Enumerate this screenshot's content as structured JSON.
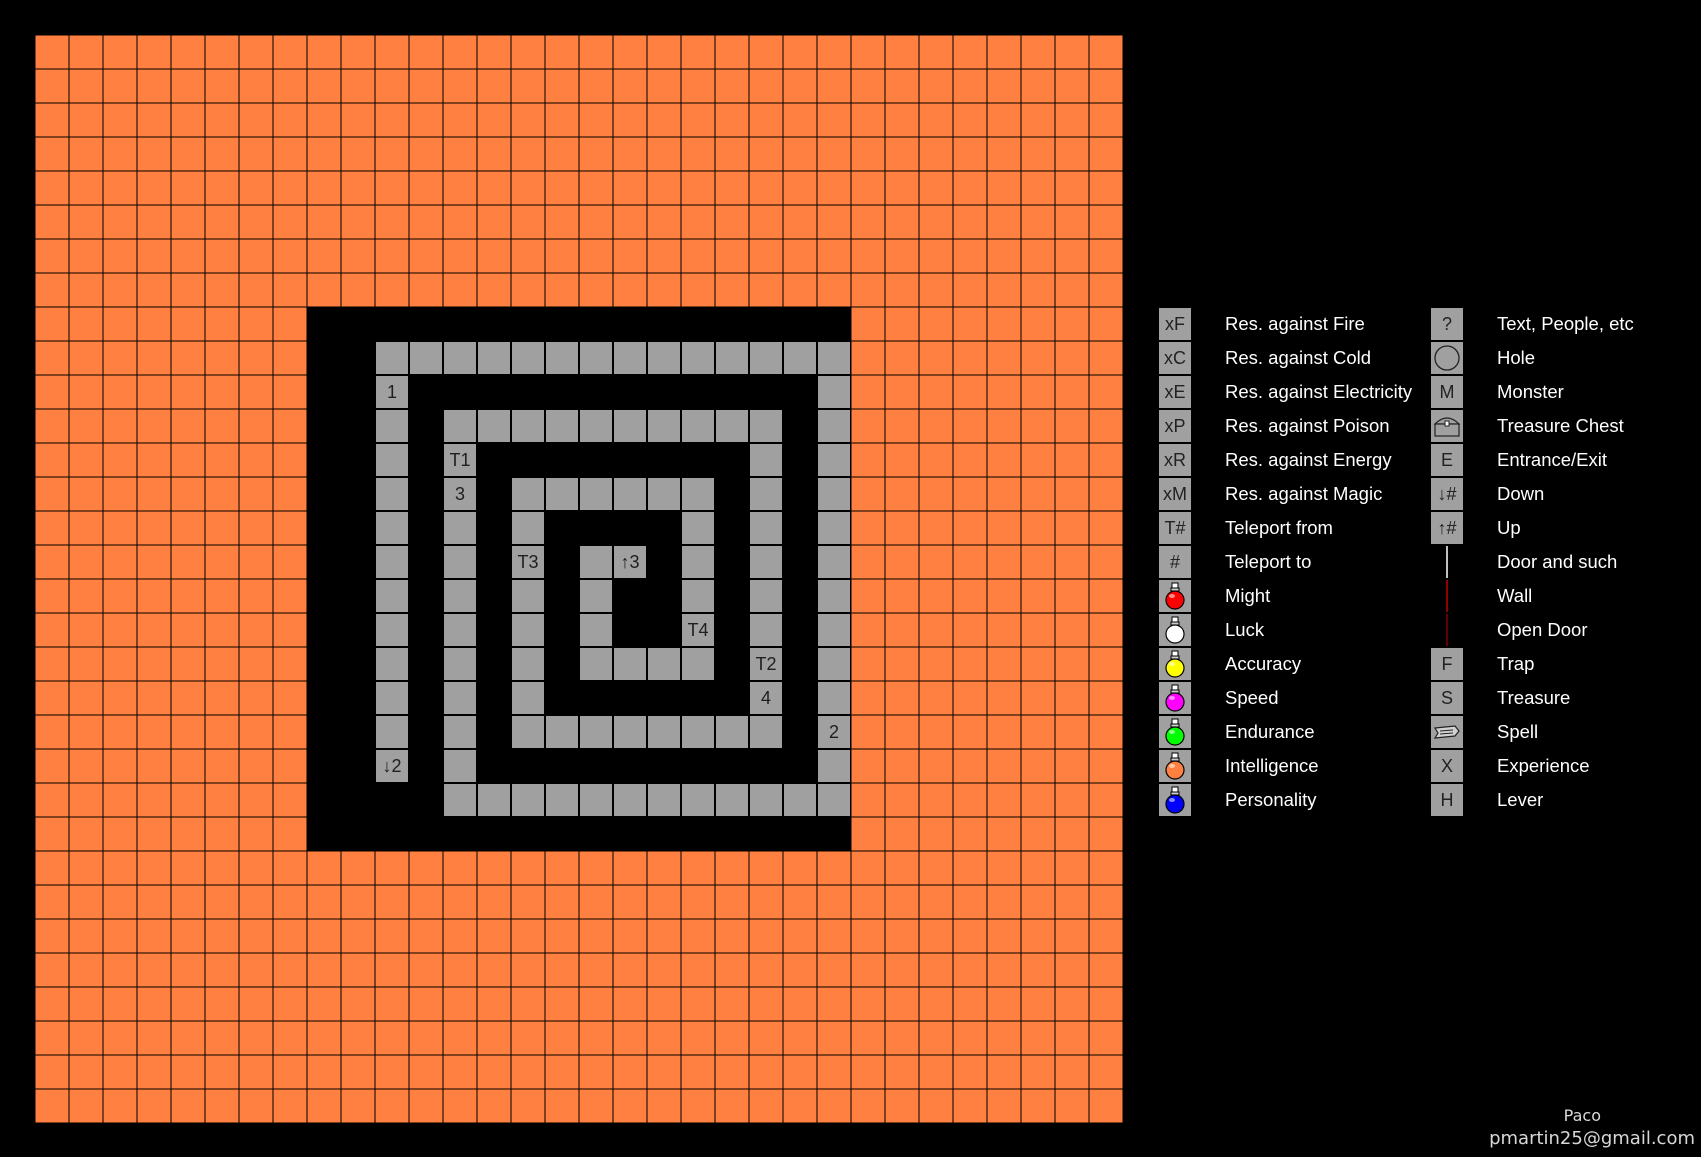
{
  "map": {
    "columns": 32,
    "rows": 32,
    "colors": {
      "outer": "#ff8040",
      "gridline": "#000000",
      "wall": "#000000",
      "floor": "#a0a0a0",
      "cell_text": "#202020"
    },
    "floor_cells": [
      [
        10,
        9
      ],
      [
        11,
        9
      ],
      [
        12,
        9
      ],
      [
        13,
        9
      ],
      [
        14,
        9
      ],
      [
        15,
        9
      ],
      [
        16,
        9
      ],
      [
        17,
        9
      ],
      [
        18,
        9
      ],
      [
        19,
        9
      ],
      [
        20,
        9
      ],
      [
        21,
        9
      ],
      [
        22,
        9
      ],
      [
        23,
        9
      ],
      [
        10,
        10
      ],
      [
        10,
        11
      ],
      [
        10,
        12
      ],
      [
        10,
        13
      ],
      [
        10,
        14
      ],
      [
        10,
        15
      ],
      [
        10,
        16
      ],
      [
        10,
        17
      ],
      [
        10,
        18
      ],
      [
        10,
        19
      ],
      [
        10,
        20
      ],
      [
        10,
        21
      ],
      [
        23,
        10
      ],
      [
        23,
        11
      ],
      [
        23,
        12
      ],
      [
        23,
        13
      ],
      [
        23,
        14
      ],
      [
        23,
        15
      ],
      [
        23,
        16
      ],
      [
        23,
        17
      ],
      [
        23,
        18
      ],
      [
        23,
        19
      ],
      [
        23,
        20
      ],
      [
        23,
        21
      ],
      [
        23,
        22
      ],
      [
        12,
        11
      ],
      [
        13,
        11
      ],
      [
        14,
        11
      ],
      [
        15,
        11
      ],
      [
        16,
        11
      ],
      [
        17,
        11
      ],
      [
        18,
        11
      ],
      [
        19,
        11
      ],
      [
        20,
        11
      ],
      [
        21,
        11
      ],
      [
        12,
        12
      ],
      [
        12,
        13
      ],
      [
        12,
        14
      ],
      [
        12,
        15
      ],
      [
        12,
        16
      ],
      [
        12,
        17
      ],
      [
        12,
        18
      ],
      [
        12,
        19
      ],
      [
        12,
        20
      ],
      [
        12,
        21
      ],
      [
        12,
        22
      ],
      [
        13,
        22
      ],
      [
        14,
        22
      ],
      [
        15,
        22
      ],
      [
        16,
        22
      ],
      [
        17,
        22
      ],
      [
        18,
        22
      ],
      [
        19,
        22
      ],
      [
        20,
        22
      ],
      [
        21,
        22
      ],
      [
        22,
        22
      ],
      [
        21,
        12
      ],
      [
        21,
        13
      ],
      [
        21,
        14
      ],
      [
        21,
        15
      ],
      [
        21,
        16
      ],
      [
        21,
        17
      ],
      [
        21,
        18
      ],
      [
        21,
        19
      ],
      [
        21,
        20
      ],
      [
        14,
        13
      ],
      [
        15,
        13
      ],
      [
        16,
        13
      ],
      [
        17,
        13
      ],
      [
        18,
        13
      ],
      [
        19,
        13
      ],
      [
        14,
        14
      ],
      [
        14,
        15
      ],
      [
        14,
        16
      ],
      [
        14,
        17
      ],
      [
        14,
        18
      ],
      [
        14,
        19
      ],
      [
        14,
        20
      ],
      [
        15,
        20
      ],
      [
        16,
        20
      ],
      [
        17,
        20
      ],
      [
        18,
        20
      ],
      [
        19,
        20
      ],
      [
        20,
        20
      ],
      [
        19,
        14
      ],
      [
        19,
        15
      ],
      [
        19,
        16
      ],
      [
        19,
        17
      ],
      [
        19,
        18
      ],
      [
        16,
        15
      ],
      [
        17,
        15
      ],
      [
        16,
        16
      ],
      [
        16,
        17
      ],
      [
        16,
        18
      ],
      [
        17,
        18
      ],
      [
        18,
        18
      ]
    ],
    "cell_labels": [
      {
        "col": 10,
        "row": 10,
        "text": "1"
      },
      {
        "col": 12,
        "row": 12,
        "text": "T1"
      },
      {
        "col": 12,
        "row": 13,
        "text": "3"
      },
      {
        "col": 14,
        "row": 15,
        "text": "T3"
      },
      {
        "col": 17,
        "row": 15,
        "text": "↑3"
      },
      {
        "col": 19,
        "row": 17,
        "text": "T4"
      },
      {
        "col": 21,
        "row": 18,
        "text": "T2"
      },
      {
        "col": 21,
        "row": 19,
        "text": "4"
      },
      {
        "col": 23,
        "row": 20,
        "text": "2"
      },
      {
        "col": 10,
        "row": 21,
        "text": "↓2"
      }
    ]
  },
  "legend": {
    "left": [
      {
        "icon": "xF",
        "label": "Res. against Fire"
      },
      {
        "icon": "xC",
        "label": "Res. against Cold"
      },
      {
        "icon": "xE",
        "label": "Res. against Electricity"
      },
      {
        "icon": "xP",
        "label": "Res. against Poison"
      },
      {
        "icon": "xR",
        "label": "Res. against Energy"
      },
      {
        "icon": "xM",
        "label": "Res. against Magic"
      },
      {
        "icon": "T#",
        "label": "Teleport from"
      },
      {
        "icon": "#",
        "label": "Teleport to"
      },
      {
        "icon": "potion-icon",
        "potion_color": "#ff0000",
        "label": "Might"
      },
      {
        "icon": "potion-icon",
        "potion_color": "#ffffff",
        "label": "Luck"
      },
      {
        "icon": "potion-icon",
        "potion_color": "#ffff00",
        "label": "Accuracy"
      },
      {
        "icon": "potion-icon",
        "potion_color": "#ff00ff",
        "label": "Speed"
      },
      {
        "icon": "potion-icon",
        "potion_color": "#00ff00",
        "label": "Endurance"
      },
      {
        "icon": "potion-icon",
        "potion_color": "#ff8040",
        "label": "Intelligence"
      },
      {
        "icon": "potion-icon",
        "potion_color": "#0000ff",
        "label": "Personality"
      }
    ],
    "right": [
      {
        "icon": "?",
        "label": "Text, People, etc"
      },
      {
        "icon": "hole-icon",
        "label": "Hole"
      },
      {
        "icon": "M",
        "label": "Monster"
      },
      {
        "icon": "chest-icon",
        "label": "Treasure Chest"
      },
      {
        "icon": "E",
        "label": "Entrance/Exit"
      },
      {
        "icon": "↓#",
        "label": "Down"
      },
      {
        "icon": "↑#",
        "label": "Up"
      },
      {
        "icon": "door-icon",
        "line_color": "#ffffff",
        "label": "Door and such"
      },
      {
        "icon": "wall-icon",
        "line_color": "#c00000",
        "label": "Wall"
      },
      {
        "icon": "open-door-icon",
        "line_color": "#800000",
        "label": "Open Door"
      },
      {
        "icon": "F",
        "label": "Trap"
      },
      {
        "icon": "S",
        "label": "Treasure"
      },
      {
        "icon": "scroll-icon",
        "label": "Spell"
      },
      {
        "icon": "X",
        "label": "Experience"
      },
      {
        "icon": "H",
        "label": "Lever"
      }
    ]
  },
  "credit": {
    "name": "Paco",
    "email": "pmartin25@gmail.com"
  }
}
